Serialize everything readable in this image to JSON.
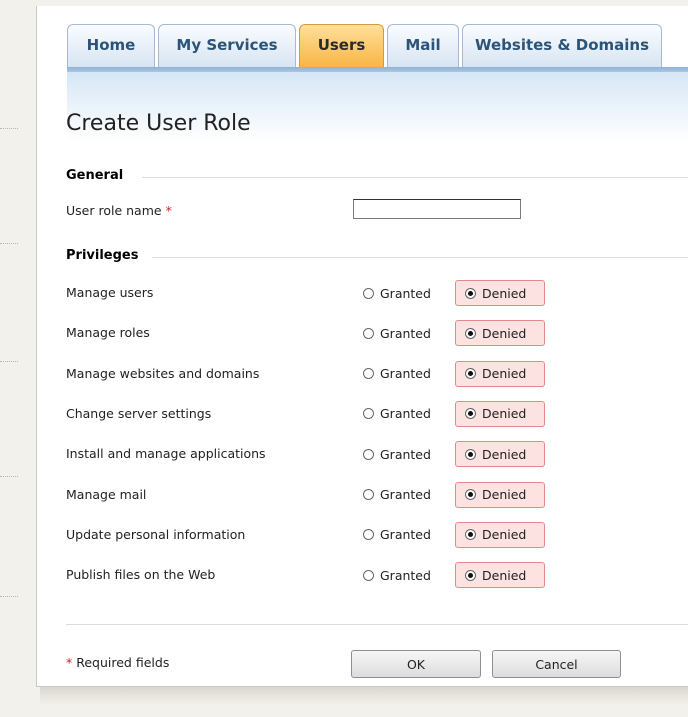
{
  "tabs": [
    {
      "label": "Home",
      "active": false
    },
    {
      "label": "My Services",
      "active": false
    },
    {
      "label": "Users",
      "active": true
    },
    {
      "label": "Mail",
      "active": false
    },
    {
      "label": "Websites & Domains",
      "active": false
    }
  ],
  "page": {
    "title": "Create User Role"
  },
  "general": {
    "heading": "General",
    "role_name_label": "User role name",
    "required_mark": "*",
    "role_name_value": ""
  },
  "privileges": {
    "heading": "Privileges",
    "granted_label": "Granted",
    "denied_label": "Denied",
    "items": [
      {
        "label": "Manage users",
        "value": "Denied"
      },
      {
        "label": "Manage roles",
        "value": "Denied"
      },
      {
        "label": "Manage websites and domains",
        "value": "Denied"
      },
      {
        "label": "Change server settings",
        "value": "Denied"
      },
      {
        "label": "Install and manage applications",
        "value": "Denied"
      },
      {
        "label": "Manage mail",
        "value": "Denied"
      },
      {
        "label": "Update personal information",
        "value": "Denied"
      },
      {
        "label": "Publish files on the Web",
        "value": "Denied"
      }
    ]
  },
  "footer": {
    "required_mark": "*",
    "required_note": "Required fields",
    "ok_label": "OK",
    "cancel_label": "Cancel"
  },
  "colors": {
    "active_tab": "#f8b544",
    "denied_bg": "#fde2e2",
    "required": "#d21f1f"
  }
}
